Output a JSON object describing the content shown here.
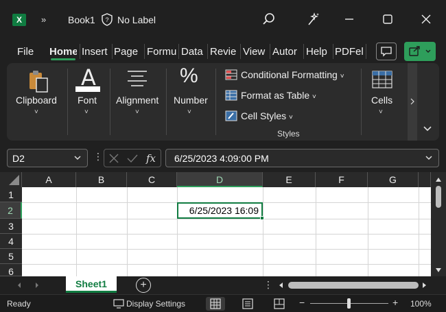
{
  "titlebar": {
    "app_icon_letter": "X",
    "overflow": "»",
    "doc_title": "Book1",
    "label": "No Label"
  },
  "tabs": [
    {
      "label": "File"
    },
    {
      "label": "Home"
    },
    {
      "label": "Insert"
    },
    {
      "label": "Page"
    },
    {
      "label": "Formu"
    },
    {
      "label": "Data"
    },
    {
      "label": "Revie"
    },
    {
      "label": "View"
    },
    {
      "label": "Autor"
    },
    {
      "label": "Help"
    },
    {
      "label": "PDFel"
    }
  ],
  "ribbon": {
    "clipboard": "Clipboard",
    "font": "Font",
    "alignment": "Alignment",
    "number": "Number",
    "number_glyph": "%",
    "font_glyph": "A",
    "conditional": "Conditional Formatting",
    "format_table": "Format as Table",
    "cell_styles": "Cell Styles",
    "styles_group": "Styles",
    "cells": "Cells",
    "caret": "˅"
  },
  "formula_bar": {
    "name_box": "D2",
    "formula_value": "6/25/2023  4:09:00 PM",
    "dots": "⋮"
  },
  "sheet": {
    "columns": [
      "A",
      "B",
      "C",
      "D",
      "E",
      "F",
      "G"
    ],
    "rows": [
      "1",
      "2",
      "3",
      "4",
      "5",
      "6"
    ],
    "active_cell_value": "6/25/2023 16:09",
    "tab_name": "Sheet1",
    "add_glyph": "+"
  },
  "status": {
    "ready": "Ready",
    "display_settings": "Display Settings",
    "zoom_minus": "−",
    "zoom_plus": "+",
    "zoom": "100%",
    "zoom_fraction": 0.5
  },
  "colors": {
    "accent": "#107c41",
    "share": "#2e9e5b",
    "background": "#202020"
  }
}
